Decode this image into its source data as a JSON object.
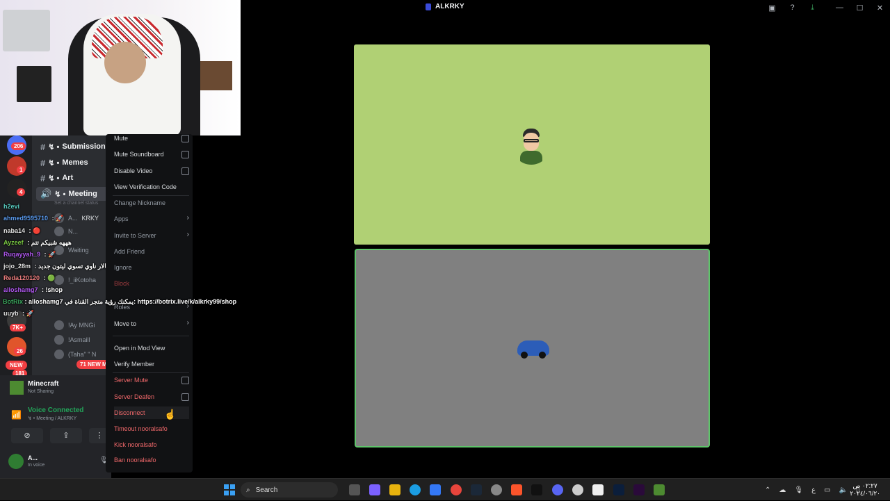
{
  "window": {
    "title": "ALKRKY"
  },
  "servers": {
    "badges": [
      "206",
      "1",
      "4",
      "7K+",
      "26",
      "NEW",
      "181"
    ]
  },
  "channels": [
    {
      "name": "Submission-F",
      "prefix": "↯ •"
    },
    {
      "name": "Memes",
      "prefix": "↯ •"
    },
    {
      "name": "Art",
      "prefix": "↯ •"
    },
    {
      "name": "Meeting",
      "prefix": "↯ •"
    }
  ],
  "channel_status_hint": "Set a channel status",
  "voice_users": [
    {
      "name": "A...",
      "tag": "KRKY"
    },
    {
      "name": "N..."
    },
    {
      "name": "Waiting"
    },
    {
      "name": "!_iiKotoha"
    },
    {
      "name": "!Ay MNGi"
    },
    {
      "name": "!Asmaill"
    },
    {
      "name": "(Taha\" \" N"
    }
  ],
  "new_messages_pill": "71 NEW MI",
  "chat_lines": [
    {
      "user": "h2evi",
      "text": "",
      "color": "#5ad1c5"
    },
    {
      "user": "ahmed9595710",
      "text": ": 🚀",
      "color": "#5b9cf0"
    },
    {
      "user": "naba14",
      "text": ": 🔴",
      "color": "#e6e6e6"
    },
    {
      "user": "Ayzeef",
      "text": ": هههه شبيكم تتم",
      "color": "#7ac943"
    },
    {
      "user": "Ruqayyah_9",
      "text": ": 🚀",
      "color": "#b058f0"
    },
    {
      "user": "jojo_28m",
      "text": ": سالار ناوي تسوي ليتون جديد",
      "color": "#e6e6e6"
    },
    {
      "user": "Reda120120",
      "text": ": 🟢",
      "color": "#f08080"
    },
    {
      "user": "alloshamg7",
      "text": ": !shop",
      "color": "#b058f0"
    },
    {
      "user": "uuyb",
      "text": ": 🚀",
      "color": "#e6e6e6"
    }
  ],
  "botrix_line": {
    "user": "BotRix",
    "text": ": alloshamg7 يمكنك رؤية متجر القناة في: https://botrix.live/k/alkrky99/shop"
  },
  "activity": {
    "title": "Minecraft",
    "subtitle": "Not Sharing"
  },
  "voice_panel": {
    "title": "Voice Connected",
    "subtitle": "↯ • Meeting / ALKRKY"
  },
  "user_panel": {
    "name": "A...",
    "status": "In voice"
  },
  "context_menu": {
    "items": [
      {
        "label": "Mute",
        "kind": "checkbox",
        "style": "normal"
      },
      {
        "label": "Mute Soundboard",
        "kind": "checkbox",
        "style": "normal"
      },
      {
        "label": "Disable Video",
        "kind": "checkbox",
        "style": "normal"
      },
      {
        "label": "View Verification Code",
        "kind": "plain",
        "style": "normal"
      },
      {
        "label": "Change Nickname",
        "kind": "plain",
        "style": "dim"
      },
      {
        "label": "Apps",
        "kind": "submenu",
        "style": "dim"
      },
      {
        "label": "Invite to Server",
        "kind": "submenu",
        "style": "dim"
      },
      {
        "label": "Add Friend",
        "kind": "plain",
        "style": "dim"
      },
      {
        "label": "Ignore",
        "kind": "plain",
        "style": "dim"
      },
      {
        "label": "Block",
        "kind": "plain",
        "style": "faint"
      },
      {
        "label": "Roles",
        "kind": "submenu",
        "style": "dim"
      },
      {
        "label": "Move to",
        "kind": "submenu",
        "style": "normal"
      },
      {
        "label": "Open in Mod View",
        "kind": "plain",
        "style": "normal"
      },
      {
        "label": "Verify Member",
        "kind": "plain",
        "style": "normal"
      },
      {
        "label": "Server Mute",
        "kind": "checkbox",
        "style": "red"
      },
      {
        "label": "Server Deafen",
        "kind": "checkbox",
        "style": "red"
      },
      {
        "label": "Disconnect",
        "kind": "plain",
        "style": "red"
      },
      {
        "label": "Timeout nooralsafo",
        "kind": "plain",
        "style": "red"
      },
      {
        "label": "Kick nooralsafo",
        "kind": "plain",
        "style": "red"
      },
      {
        "label": "Ban nooralsafo",
        "kind": "plain",
        "style": "red"
      }
    ]
  },
  "taskbar": {
    "search_label": "Search",
    "clock_time": "٠٢:٢٧ ص",
    "clock_date": "٢٠٢٤/٠٦/٢٠"
  },
  "colors": {
    "tile_top": "#b0d074",
    "tile_bottom": "#808080",
    "speaking_border": "#5fc46b",
    "danger": "#f0686a",
    "voice_green": "#23a55a"
  }
}
